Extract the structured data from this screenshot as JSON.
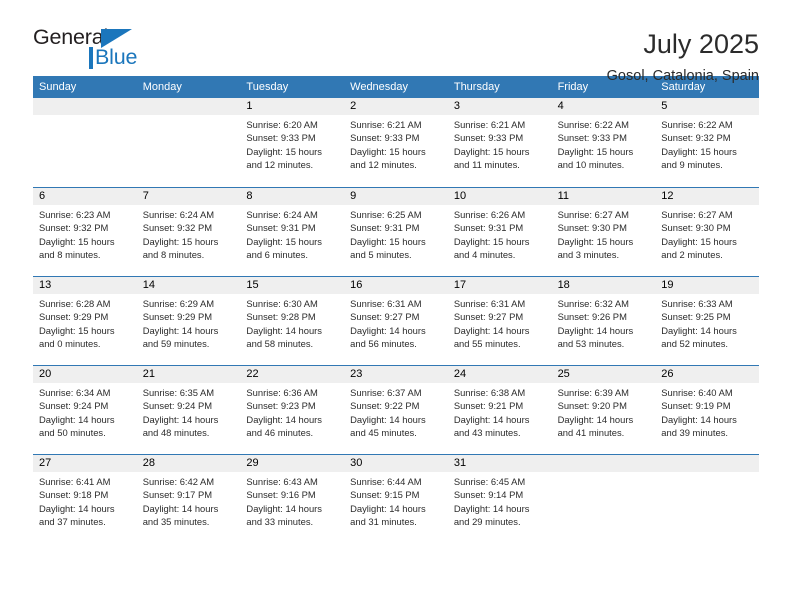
{
  "brand": {
    "name_part1": "General",
    "name_part2": "Blue",
    "triangle_icon": "triangle-icon"
  },
  "header": {
    "title": "July 2025",
    "subtitle": "Gosol, Catalonia, Spain"
  },
  "colors": {
    "header_blue": "#3178b4",
    "brand_blue": "#1b76bc",
    "daynum_gray": "#efefef",
    "text": "#2b2b2b"
  },
  "weekdays": [
    "Sunday",
    "Monday",
    "Tuesday",
    "Wednesday",
    "Thursday",
    "Friday",
    "Saturday"
  ],
  "weeks": [
    [
      {
        "day": "",
        "lines": []
      },
      {
        "day": "",
        "lines": []
      },
      {
        "day": "1",
        "lines": [
          "Sunrise: 6:20 AM",
          "Sunset: 9:33 PM",
          "Daylight: 15 hours",
          "and 12 minutes."
        ]
      },
      {
        "day": "2",
        "lines": [
          "Sunrise: 6:21 AM",
          "Sunset: 9:33 PM",
          "Daylight: 15 hours",
          "and 12 minutes."
        ]
      },
      {
        "day": "3",
        "lines": [
          "Sunrise: 6:21 AM",
          "Sunset: 9:33 PM",
          "Daylight: 15 hours",
          "and 11 minutes."
        ]
      },
      {
        "day": "4",
        "lines": [
          "Sunrise: 6:22 AM",
          "Sunset: 9:33 PM",
          "Daylight: 15 hours",
          "and 10 minutes."
        ]
      },
      {
        "day": "5",
        "lines": [
          "Sunrise: 6:22 AM",
          "Sunset: 9:32 PM",
          "Daylight: 15 hours",
          "and 9 minutes."
        ]
      }
    ],
    [
      {
        "day": "6",
        "lines": [
          "Sunrise: 6:23 AM",
          "Sunset: 9:32 PM",
          "Daylight: 15 hours",
          "and 8 minutes."
        ]
      },
      {
        "day": "7",
        "lines": [
          "Sunrise: 6:24 AM",
          "Sunset: 9:32 PM",
          "Daylight: 15 hours",
          "and 8 minutes."
        ]
      },
      {
        "day": "8",
        "lines": [
          "Sunrise: 6:24 AM",
          "Sunset: 9:31 PM",
          "Daylight: 15 hours",
          "and 6 minutes."
        ]
      },
      {
        "day": "9",
        "lines": [
          "Sunrise: 6:25 AM",
          "Sunset: 9:31 PM",
          "Daylight: 15 hours",
          "and 5 minutes."
        ]
      },
      {
        "day": "10",
        "lines": [
          "Sunrise: 6:26 AM",
          "Sunset: 9:31 PM",
          "Daylight: 15 hours",
          "and 4 minutes."
        ]
      },
      {
        "day": "11",
        "lines": [
          "Sunrise: 6:27 AM",
          "Sunset: 9:30 PM",
          "Daylight: 15 hours",
          "and 3 minutes."
        ]
      },
      {
        "day": "12",
        "lines": [
          "Sunrise: 6:27 AM",
          "Sunset: 9:30 PM",
          "Daylight: 15 hours",
          "and 2 minutes."
        ]
      }
    ],
    [
      {
        "day": "13",
        "lines": [
          "Sunrise: 6:28 AM",
          "Sunset: 9:29 PM",
          "Daylight: 15 hours",
          "and 0 minutes."
        ]
      },
      {
        "day": "14",
        "lines": [
          "Sunrise: 6:29 AM",
          "Sunset: 9:29 PM",
          "Daylight: 14 hours",
          "and 59 minutes."
        ]
      },
      {
        "day": "15",
        "lines": [
          "Sunrise: 6:30 AM",
          "Sunset: 9:28 PM",
          "Daylight: 14 hours",
          "and 58 minutes."
        ]
      },
      {
        "day": "16",
        "lines": [
          "Sunrise: 6:31 AM",
          "Sunset: 9:27 PM",
          "Daylight: 14 hours",
          "and 56 minutes."
        ]
      },
      {
        "day": "17",
        "lines": [
          "Sunrise: 6:31 AM",
          "Sunset: 9:27 PM",
          "Daylight: 14 hours",
          "and 55 minutes."
        ]
      },
      {
        "day": "18",
        "lines": [
          "Sunrise: 6:32 AM",
          "Sunset: 9:26 PM",
          "Daylight: 14 hours",
          "and 53 minutes."
        ]
      },
      {
        "day": "19",
        "lines": [
          "Sunrise: 6:33 AM",
          "Sunset: 9:25 PM",
          "Daylight: 14 hours",
          "and 52 minutes."
        ]
      }
    ],
    [
      {
        "day": "20",
        "lines": [
          "Sunrise: 6:34 AM",
          "Sunset: 9:24 PM",
          "Daylight: 14 hours",
          "and 50 minutes."
        ]
      },
      {
        "day": "21",
        "lines": [
          "Sunrise: 6:35 AM",
          "Sunset: 9:24 PM",
          "Daylight: 14 hours",
          "and 48 minutes."
        ]
      },
      {
        "day": "22",
        "lines": [
          "Sunrise: 6:36 AM",
          "Sunset: 9:23 PM",
          "Daylight: 14 hours",
          "and 46 minutes."
        ]
      },
      {
        "day": "23",
        "lines": [
          "Sunrise: 6:37 AM",
          "Sunset: 9:22 PM",
          "Daylight: 14 hours",
          "and 45 minutes."
        ]
      },
      {
        "day": "24",
        "lines": [
          "Sunrise: 6:38 AM",
          "Sunset: 9:21 PM",
          "Daylight: 14 hours",
          "and 43 minutes."
        ]
      },
      {
        "day": "25",
        "lines": [
          "Sunrise: 6:39 AM",
          "Sunset: 9:20 PM",
          "Daylight: 14 hours",
          "and 41 minutes."
        ]
      },
      {
        "day": "26",
        "lines": [
          "Sunrise: 6:40 AM",
          "Sunset: 9:19 PM",
          "Daylight: 14 hours",
          "and 39 minutes."
        ]
      }
    ],
    [
      {
        "day": "27",
        "lines": [
          "Sunrise: 6:41 AM",
          "Sunset: 9:18 PM",
          "Daylight: 14 hours",
          "and 37 minutes."
        ]
      },
      {
        "day": "28",
        "lines": [
          "Sunrise: 6:42 AM",
          "Sunset: 9:17 PM",
          "Daylight: 14 hours",
          "and 35 minutes."
        ]
      },
      {
        "day": "29",
        "lines": [
          "Sunrise: 6:43 AM",
          "Sunset: 9:16 PM",
          "Daylight: 14 hours",
          "and 33 minutes."
        ]
      },
      {
        "day": "30",
        "lines": [
          "Sunrise: 6:44 AM",
          "Sunset: 9:15 PM",
          "Daylight: 14 hours",
          "and 31 minutes."
        ]
      },
      {
        "day": "31",
        "lines": [
          "Sunrise: 6:45 AM",
          "Sunset: 9:14 PM",
          "Daylight: 14 hours",
          "and 29 minutes."
        ]
      },
      {
        "day": "",
        "lines": []
      },
      {
        "day": "",
        "lines": []
      }
    ]
  ]
}
